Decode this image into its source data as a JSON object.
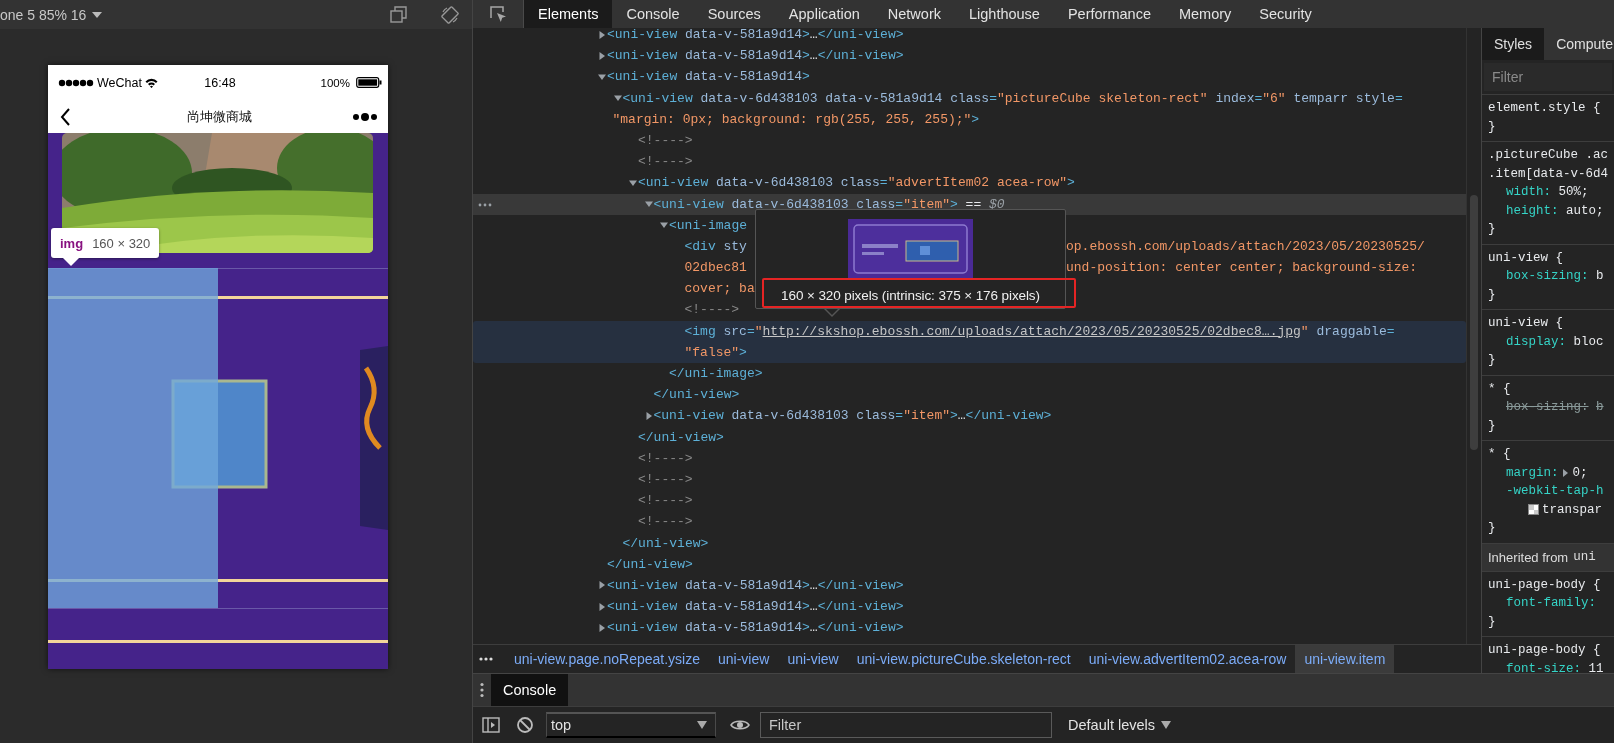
{
  "device_toolbar": {
    "device_label": "one 5 85% 16"
  },
  "phone": {
    "status_bar": {
      "carrier": "WeChat",
      "time": "16:48",
      "battery": "100%"
    },
    "nav_bar": {
      "title": "尚坤微商城"
    },
    "element_tooltip": {
      "tag": "img",
      "size": "160 × 320"
    }
  },
  "devtools": {
    "tabs": [
      {
        "label": "Elements",
        "selected": true
      },
      {
        "label": "Console",
        "selected": false
      },
      {
        "label": "Sources",
        "selected": false
      },
      {
        "label": "Application",
        "selected": false
      },
      {
        "label": "Network",
        "selected": false
      },
      {
        "label": "Lighthouse",
        "selected": false
      },
      {
        "label": "Performance",
        "selected": false
      },
      {
        "label": "Memory",
        "selected": false
      },
      {
        "label": "Security",
        "selected": false
      }
    ],
    "elements": {
      "nodes": [
        {
          "segs": [
            {
              "kind": "tag",
              "text": "<uni-view"
            },
            {
              "kind": "attr",
              "text": " data-v-581a9d14"
            },
            {
              "kind": "tag",
              "text": ">"
            },
            {
              "kind": "text",
              "text": "…"
            },
            {
              "kind": "tag",
              "text": "</uni-view>"
            }
          ],
          "expanded": false
        },
        {
          "segs": [
            {
              "kind": "tag",
              "text": "<uni-view"
            },
            {
              "kind": "attr",
              "text": " data-v-581a9d14"
            },
            {
              "kind": "tag",
              "text": ">"
            },
            {
              "kind": "text",
              "text": "…"
            },
            {
              "kind": "tag",
              "text": "</uni-view>"
            }
          ],
          "expanded": false
        },
        {
          "segs": [
            {
              "kind": "tag",
              "text": "<uni-view"
            },
            {
              "kind": "attr",
              "text": " data-v-581a9d14"
            },
            {
              "kind": "tag",
              "text": ">"
            }
          ],
          "expanded": true,
          "close": [
            {
              "kind": "tag",
              "text": "</uni-view>"
            }
          ],
          "children": [
            {
              "segs": [
                {
                  "kind": "tag",
                  "text": "<uni-view"
                },
                {
                  "kind": "attr",
                  "text": " data-v-6d438103 data-v-581a9d14 class"
                },
                {
                  "kind": "tag",
                  "text": "="
                },
                {
                  "kind": "val",
                  "text": "\"pictureCube skeleton-rect\""
                },
                {
                  "kind": "attr",
                  "text": " index"
                },
                {
                  "kind": "tag",
                  "text": "="
                },
                {
                  "kind": "val",
                  "text": "\"6\""
                },
                {
                  "kind": "attr",
                  "text": " temparr style"
                },
                {
                  "kind": "tag",
                  "text": "="
                }
              ],
              "more": [
                {
                  "segs": [
                    {
                      "kind": "val",
                      "text": "\"margin: 0px; background: rgb(255, 255, 255);\""
                    },
                    {
                      "kind": "tag",
                      "text": ">"
                    }
                  ]
                }
              ],
              "expanded": true,
              "close": [
                {
                  "kind": "tag",
                  "text": "</uni-view>"
                }
              ],
              "children": [
                {
                  "segs": [
                    {
                      "kind": "comment",
                      "text": "<!---->"
                    }
                  ]
                },
                {
                  "segs": [
                    {
                      "kind": "comment",
                      "text": "<!---->"
                    }
                  ]
                },
                {
                  "segs": [
                    {
                      "kind": "tag",
                      "text": "<uni-view"
                    },
                    {
                      "kind": "attr",
                      "text": " data-v-6d438103 class"
                    },
                    {
                      "kind": "tag",
                      "text": "="
                    },
                    {
                      "kind": "val",
                      "text": "\"advertItem02 acea-row\""
                    },
                    {
                      "kind": "tag",
                      "text": ">"
                    }
                  ],
                  "expanded": true,
                  "close": [
                    {
                      "kind": "tag",
                      "text": "</uni-view>"
                    }
                  ],
                  "children": [
                    {
                      "segs": [
                        {
                          "kind": "tag",
                          "text": "<uni-view"
                        },
                        {
                          "kind": "attr",
                          "text": " data-v-6d438103 class"
                        },
                        {
                          "kind": "tag",
                          "text": "="
                        },
                        {
                          "kind": "val",
                          "text": "\"item\""
                        },
                        {
                          "kind": "tag",
                          "text": ">"
                        },
                        {
                          "kind": "text",
                          "text": " == "
                        },
                        {
                          "kind": "ref",
                          "text": "$0"
                        }
                      ],
                      "expanded": true,
                      "selected": true,
                      "close": [
                        {
                          "kind": "tag",
                          "text": "</uni-view>"
                        }
                      ],
                      "children": [
                        {
                          "segs": [
                            {
                              "kind": "tag",
                              "text": "<uni-image"
                            }
                          ],
                          "expanded": true,
                          "close": [
                            {
                              "kind": "tag",
                              "text": "</uni-image>"
                            }
                          ],
                          "children": [
                            {
                              "segs": [
                                {
                                  "kind": "tag",
                                  "text": "<div"
                                },
                                {
                                  "kind": "attr",
                                  "text": " sty"
                                }
                              ],
                              "right": [
                                {
                                  "kind": "val",
                                  "text": "op.ebossh.com/uploads/attach/2023/05/20230525/"
                                }
                              ],
                              "more": [
                                {
                                  "segs": [
                                    {
                                      "kind": "val",
                                      "text": "02dbec81"
                                    }
                                  ],
                                  "right": [
                                    {
                                      "kind": "val",
                                      "text": "und-position: center center; background-size:"
                                    }
                                  ]
                                },
                                {
                                  "segs": [
                                    {
                                      "kind": "val",
                                      "text": "cover; ba"
                                    }
                                  ]
                                }
                              ]
                            },
                            {
                              "segs": [
                                {
                                  "kind": "comment",
                                  "text": "<!---->"
                                }
                              ]
                            },
                            {
                              "segs": [
                                {
                                  "kind": "tag",
                                  "text": "<img"
                                },
                                {
                                  "kind": "attr",
                                  "text": " src"
                                },
                                {
                                  "kind": "tag",
                                  "text": "="
                                },
                                {
                                  "kind": "val",
                                  "text": "\""
                                },
                                {
                                  "kind": "link",
                                  "text": "http://skshop.ebossh.com/uploads/attach/2023/05/20230525/02dbec8….jpg"
                                },
                                {
                                  "kind": "val",
                                  "text": "\""
                                },
                                {
                                  "kind": "attr",
                                  "text": " draggable"
                                },
                                {
                                  "kind": "tag",
                                  "text": "="
                                }
                              ],
                              "more": [
                                {
                                  "segs": [
                                    {
                                      "kind": "val",
                                      "text": "\"false\""
                                    },
                                    {
                                      "kind": "tag",
                                      "text": ">"
                                    }
                                  ]
                                }
                              ],
                              "hovered": true
                            }
                          ]
                        }
                      ]
                    },
                    {
                      "segs": [
                        {
                          "kind": "tag",
                          "text": "<uni-view"
                        },
                        {
                          "kind": "attr",
                          "text": " data-v-6d438103 class"
                        },
                        {
                          "kind": "tag",
                          "text": "="
                        },
                        {
                          "kind": "val",
                          "text": "\"item\""
                        },
                        {
                          "kind": "tag",
                          "text": ">"
                        },
                        {
                          "kind": "text",
                          "text": "…"
                        },
                        {
                          "kind": "tag",
                          "text": "</uni-view>"
                        }
                      ],
                      "expanded": false
                    }
                  ]
                },
                {
                  "segs": [
                    {
                      "kind": "comment",
                      "text": "<!---->"
                    }
                  ]
                },
                {
                  "segs": [
                    {
                      "kind": "comment",
                      "text": "<!---->"
                    }
                  ]
                },
                {
                  "segs": [
                    {
                      "kind": "comment",
                      "text": "<!---->"
                    }
                  ]
                },
                {
                  "segs": [
                    {
                      "kind": "comment",
                      "text": "<!---->"
                    }
                  ]
                }
              ]
            }
          ]
        },
        {
          "segs": [
            {
              "kind": "tag",
              "text": "<uni-view"
            },
            {
              "kind": "attr",
              "text": " data-v-581a9d14"
            },
            {
              "kind": "tag",
              "text": ">"
            },
            {
              "kind": "text",
              "text": "…"
            },
            {
              "kind": "tag",
              "text": "</uni-view>"
            }
          ],
          "expanded": false
        },
        {
          "segs": [
            {
              "kind": "tag",
              "text": "<uni-view"
            },
            {
              "kind": "attr",
              "text": " data-v-581a9d14"
            },
            {
              "kind": "tag",
              "text": ">"
            },
            {
              "kind": "text",
              "text": "…"
            },
            {
              "kind": "tag",
              "text": "</uni-view>"
            }
          ],
          "expanded": false
        },
        {
          "segs": [
            {
              "kind": "tag",
              "text": "<uni-view"
            },
            {
              "kind": "attr",
              "text": " data-v-581a9d14"
            },
            {
              "kind": "tag",
              "text": ">"
            },
            {
              "kind": "text",
              "text": "…"
            },
            {
              "kind": "tag",
              "text": "</uni-view>"
            }
          ],
          "expanded": false
        }
      ]
    },
    "image_preview": {
      "caption": "160 × 320 pixels (intrinsic: 375 × 176 pixels)"
    },
    "breadcrumbs": [
      {
        "label": "uni-view.page.noRepeat.ysize",
        "selected": false
      },
      {
        "label": "uni-view",
        "selected": false
      },
      {
        "label": "uni-view",
        "selected": false
      },
      {
        "label": "uni-view.pictureCube.skeleton-rect",
        "selected": false
      },
      {
        "label": "uni-view.advertItem02.acea-row",
        "selected": false
      },
      {
        "label": "uni-view.item",
        "selected": true
      }
    ],
    "drawer": {
      "tabs": [
        {
          "label": "Console",
          "selected": true
        }
      ],
      "context": "top",
      "filter_placeholder": "Filter",
      "levels": "Default levels"
    }
  },
  "styles_pane": {
    "tabs": [
      {
        "label": "Styles",
        "selected": true
      },
      {
        "label": "Compute",
        "selected": false
      }
    ],
    "filter_placeholder": "Filter",
    "blocks": [
      {
        "kind": "rule",
        "selector": [
          "element.style {"
        ],
        "close": "}"
      },
      {
        "kind": "rule",
        "selector": [
          ".pictureCube .ac",
          ".item[data-v-6d4"
        ],
        "declarations": [
          {
            "kind": "decl",
            "property": "width:",
            "value": "50%;",
            "overridden": false,
            "expandable": false
          },
          {
            "kind": "decl",
            "property": "height:",
            "value": "auto;",
            "overridden": false,
            "expandable": false
          }
        ],
        "close": "}"
      },
      {
        "kind": "rule",
        "selector": [
          "uni-view {"
        ],
        "declarations": [
          {
            "kind": "decl",
            "property": "box-sizing:",
            "value": "b",
            "overridden": false,
            "expandable": false
          }
        ],
        "close": "}"
      },
      {
        "kind": "rule",
        "selector": [
          "uni-view {"
        ],
        "declarations": [
          {
            "kind": "decl",
            "property": "display:",
            "value": "bloc",
            "overridden": false,
            "expandable": false
          }
        ],
        "close": "}"
      },
      {
        "kind": "rule",
        "selector": [
          "* {"
        ],
        "declarations": [
          {
            "kind": "decl",
            "property": "box-sizing:",
            "value": "b",
            "overridden": true,
            "expandable": false
          }
        ],
        "close": "}"
      },
      {
        "kind": "rule",
        "selector": [
          "* {"
        ],
        "declarations": [
          {
            "kind": "decl",
            "property": "margin:",
            "value": "0;",
            "overridden": false,
            "expandable": true
          },
          {
            "kind": "decl",
            "property": "-webkit-tap-h",
            "overridden": false,
            "expandable": false
          },
          {
            "kind": "continuation",
            "value": "transpar"
          }
        ],
        "close": "}"
      },
      {
        "kind": "inherited",
        "label": "Inherited from",
        "source": "uni"
      },
      {
        "kind": "rule",
        "selector": [
          "uni-page-body {"
        ],
        "declarations": [
          {
            "kind": "decl",
            "property": "font-family:",
            "overridden": false,
            "expandable": false
          }
        ],
        "close": "}"
      },
      {
        "kind": "rule",
        "selector": [
          "uni-page-body {"
        ],
        "declarations": [
          {
            "kind": "decl",
            "property": "font-size:",
            "value": "11",
            "overridden": false,
            "expandable": false
          }
        ]
      }
    ]
  }
}
